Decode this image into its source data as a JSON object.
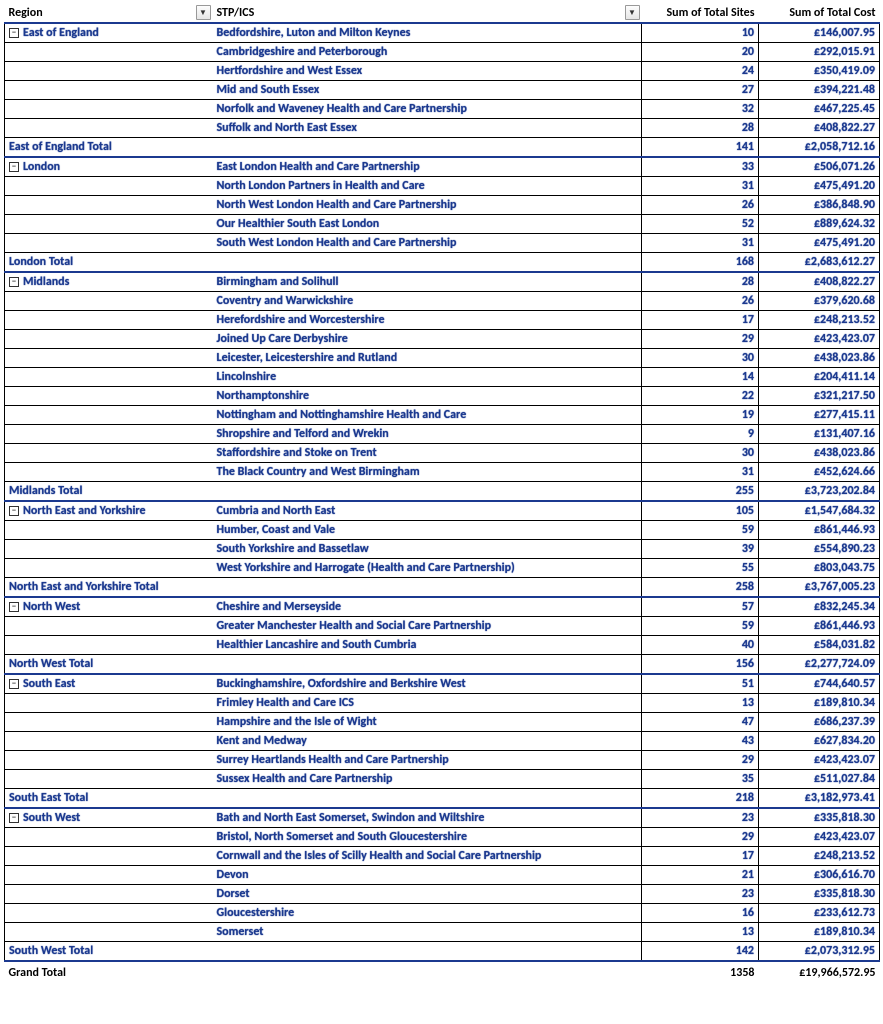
{
  "headers": {
    "region": "Region",
    "stp": "STP/ICS",
    "sites": "Sum of Total Sites",
    "cost": "Sum of Total Cost"
  },
  "regions": [
    {
      "name": "East of England",
      "rows": [
        {
          "stp": "Bedfordshire, Luton and Milton Keynes",
          "sites": "10",
          "cost": "£146,007.95"
        },
        {
          "stp": "Cambridgeshire and Peterborough",
          "sites": "20",
          "cost": "£292,015.91"
        },
        {
          "stp": "Hertfordshire and West Essex",
          "sites": "24",
          "cost": "£350,419.09"
        },
        {
          "stp": "Mid and South Essex",
          "sites": "27",
          "cost": "£394,221.48"
        },
        {
          "stp": "Norfolk and Waveney Health and Care Partnership",
          "sites": "32",
          "cost": "£467,225.45"
        },
        {
          "stp": "Suffolk and North East Essex",
          "sites": "28",
          "cost": "£408,822.27"
        }
      ],
      "subtotal_label": "East of England Total",
      "subtotal_sites": "141",
      "subtotal_cost": "£2,058,712.16"
    },
    {
      "name": "London",
      "rows": [
        {
          "stp": "East London Health and Care Partnership",
          "sites": "33",
          "cost": "£506,071.26"
        },
        {
          "stp": "North London Partners in Health and Care",
          "sites": "31",
          "cost": "£475,491.20"
        },
        {
          "stp": "North West London Health and Care Partnership",
          "sites": "26",
          "cost": "£386,848.90"
        },
        {
          "stp": "Our Healthier South East London",
          "sites": "52",
          "cost": "£889,624.32"
        },
        {
          "stp": "South West London Health and Care Partnership",
          "sites": "31",
          "cost": "£475,491.20"
        }
      ],
      "subtotal_label": "London Total",
      "subtotal_sites": "168",
      "subtotal_cost": "£2,683,612.27"
    },
    {
      "name": "Midlands",
      "rows": [
        {
          "stp": "Birmingham and Solihull",
          "sites": "28",
          "cost": "£408,822.27"
        },
        {
          "stp": "Coventry and Warwickshire",
          "sites": "26",
          "cost": "£379,620.68"
        },
        {
          "stp": "Herefordshire and Worcestershire",
          "sites": "17",
          "cost": "£248,213.52"
        },
        {
          "stp": "Joined Up Care Derbyshire",
          "sites": "29",
          "cost": "£423,423.07"
        },
        {
          "stp": "Leicester, Leicestershire and Rutland",
          "sites": "30",
          "cost": "£438,023.86"
        },
        {
          "stp": "Lincolnshire",
          "sites": "14",
          "cost": "£204,411.14"
        },
        {
          "stp": "Northamptonshire",
          "sites": "22",
          "cost": "£321,217.50"
        },
        {
          "stp": "Nottingham and Nottinghamshire Health and Care",
          "sites": "19",
          "cost": "£277,415.11"
        },
        {
          "stp": "Shropshire and Telford and Wrekin",
          "sites": "9",
          "cost": "£131,407.16"
        },
        {
          "stp": "Staffordshire and Stoke on Trent",
          "sites": "30",
          "cost": "£438,023.86"
        },
        {
          "stp": "The Black Country and West Birmingham",
          "sites": "31",
          "cost": "£452,624.66"
        }
      ],
      "subtotal_label": "Midlands Total",
      "subtotal_sites": "255",
      "subtotal_cost": "£3,723,202.84"
    },
    {
      "name": "North East and Yorkshire",
      "rows": [
        {
          "stp": "Cumbria and North East",
          "sites": "105",
          "cost": "£1,547,684.32"
        },
        {
          "stp": "Humber, Coast and Vale",
          "sites": "59",
          "cost": "£861,446.93"
        },
        {
          "stp": "South Yorkshire and Bassetlaw",
          "sites": "39",
          "cost": "£554,890.23"
        },
        {
          "stp": "West Yorkshire and Harrogate (Health and Care Partnership)",
          "sites": "55",
          "cost": "£803,043.75"
        }
      ],
      "subtotal_label": "North East and Yorkshire Total",
      "subtotal_sites": "258",
      "subtotal_cost": "£3,767,005.23"
    },
    {
      "name": "North West",
      "rows": [
        {
          "stp": "Cheshire and Merseyside",
          "sites": "57",
          "cost": "£832,245.34"
        },
        {
          "stp": "Greater Manchester Health and Social Care Partnership",
          "sites": "59",
          "cost": "£861,446.93"
        },
        {
          "stp": "Healthier Lancashire and South Cumbria",
          "sites": "40",
          "cost": "£584,031.82"
        }
      ],
      "subtotal_label": "North West Total",
      "subtotal_sites": "156",
      "subtotal_cost": "£2,277,724.09"
    },
    {
      "name": "South East",
      "rows": [
        {
          "stp": "Buckinghamshire, Oxfordshire and Berkshire West",
          "sites": "51",
          "cost": "£744,640.57"
        },
        {
          "stp": "Frimley Health and Care ICS",
          "sites": "13",
          "cost": "£189,810.34"
        },
        {
          "stp": "Hampshire and the Isle of Wight",
          "sites": "47",
          "cost": "£686,237.39"
        },
        {
          "stp": "Kent and Medway",
          "sites": "43",
          "cost": "£627,834.20"
        },
        {
          "stp": "Surrey Heartlands Health and Care Partnership",
          "sites": "29",
          "cost": "£423,423.07"
        },
        {
          "stp": "Sussex Health and Care Partnership",
          "sites": "35",
          "cost": "£511,027.84"
        }
      ],
      "subtotal_label": "South East Total",
      "subtotal_sites": "218",
      "subtotal_cost": "£3,182,973.41"
    },
    {
      "name": "South West",
      "rows": [
        {
          "stp": "Bath and North East Somerset, Swindon and Wiltshire",
          "sites": "23",
          "cost": "£335,818.30"
        },
        {
          "stp": "Bristol, North Somerset and South Gloucestershire",
          "sites": "29",
          "cost": "£423,423.07"
        },
        {
          "stp": "Cornwall and the Isles of Scilly Health and Social Care Partnership",
          "sites": "17",
          "cost": "£248,213.52"
        },
        {
          "stp": "Devon",
          "sites": "21",
          "cost": "£306,616.70"
        },
        {
          "stp": "Dorset",
          "sites": "23",
          "cost": "£335,818.30"
        },
        {
          "stp": "Gloucestershire",
          "sites": "16",
          "cost": "£233,612.73"
        },
        {
          "stp": "Somerset",
          "sites": "13",
          "cost": "£189,810.34"
        }
      ],
      "subtotal_label": "South West Total",
      "subtotal_sites": "142",
      "subtotal_cost": "£2,073,312.95"
    }
  ],
  "grand_total": {
    "label": "Grand Total",
    "sites": "1358",
    "cost": "£19,966,572.95"
  }
}
